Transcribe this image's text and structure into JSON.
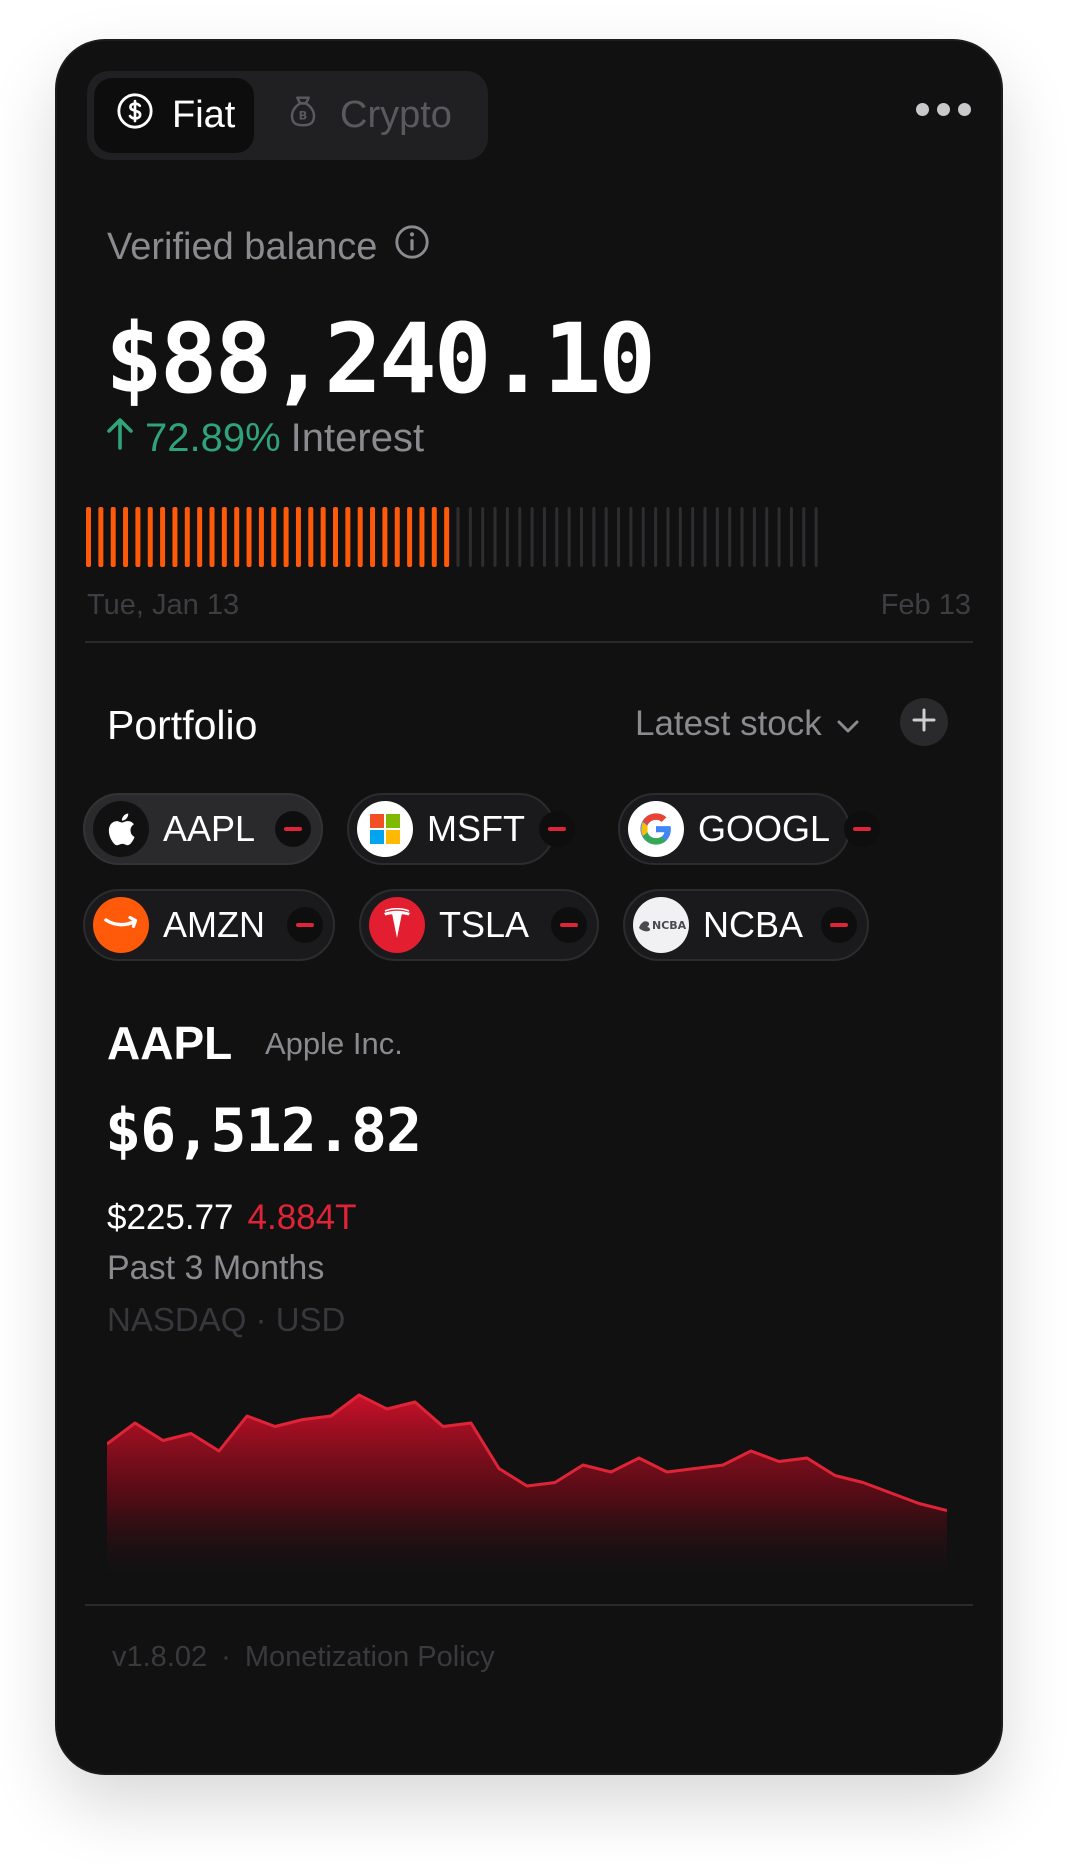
{
  "tabs": [
    {
      "label": "Fiat",
      "icon": "dollar-circle-icon",
      "active": true
    },
    {
      "label": "Crypto",
      "icon": "money-bag-icon",
      "active": false
    }
  ],
  "balance": {
    "label": "Verified balance",
    "value": "$88,240.10",
    "change_pct": "72.89%",
    "change_label": "Interest",
    "change_color": "#2fa37a"
  },
  "progress": {
    "filled_fraction": 0.5,
    "filled_color": "#ff5a0a",
    "start_label": "Tue, Jan 13",
    "end_label": "Feb 13"
  },
  "portfolio": {
    "title": "Portfolio",
    "filter_label": "Latest stock",
    "chips": [
      {
        "ticker": "AAPL",
        "logo": "apple-icon",
        "active": true
      },
      {
        "ticker": "MSFT",
        "logo": "microsoft-icon",
        "active": false
      },
      {
        "ticker": "GOOGL",
        "logo": "google-icon",
        "active": false
      },
      {
        "ticker": "AMZN",
        "logo": "amazon-icon",
        "active": false
      },
      {
        "ticker": "TSLA",
        "logo": "tesla-icon",
        "active": false
      },
      {
        "ticker": "NCBA",
        "logo": "ncba-icon",
        "active": false
      }
    ]
  },
  "stock": {
    "ticker": "AAPL",
    "company": "Apple Inc.",
    "value": "$6,512.82",
    "price": "$225.77",
    "market_cap": "4.884T",
    "period": "Past 3 Months",
    "exchange": "NASDAQ · USD",
    "accent": "#e02437"
  },
  "chart_data": {
    "type": "area",
    "values": [
      52,
      58,
      53,
      55,
      50,
      60,
      57,
      59,
      60,
      66,
      62,
      64,
      57,
      58,
      45,
      40,
      41,
      46,
      44,
      48,
      44,
      45,
      46,
      50,
      47,
      48,
      43,
      41,
      38,
      35,
      33
    ],
    "title": "",
    "xlabel": "",
    "ylabel": ""
  },
  "footer": {
    "version": "v1.8.02",
    "separator": "·",
    "link": "Monetization Policy"
  }
}
